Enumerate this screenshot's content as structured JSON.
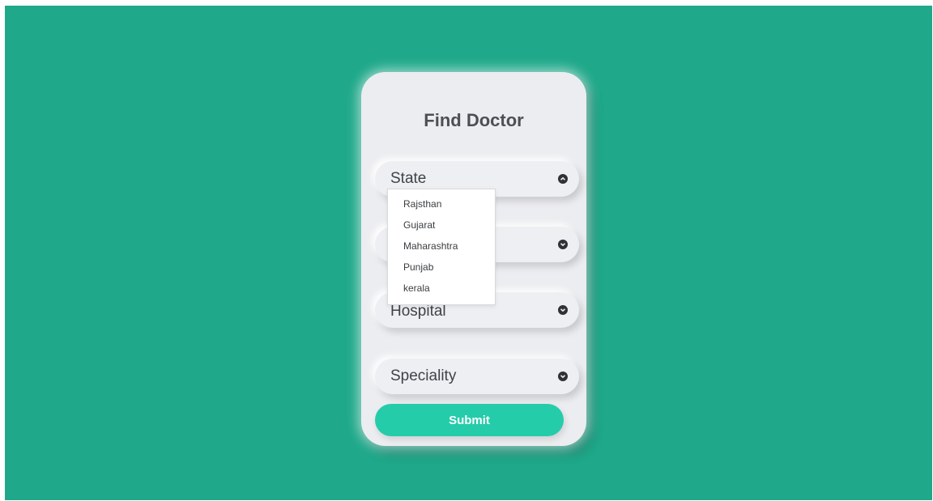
{
  "form": {
    "title": "Find Doctor",
    "fields": [
      {
        "label": "State",
        "open": true
      },
      {
        "label": "",
        "open": false
      },
      {
        "label": "Hospital",
        "open": false
      },
      {
        "label": "Speciality",
        "open": false
      }
    ],
    "state_options": [
      "Rajsthan",
      "Gujarat",
      "Maharashtra",
      "Punjab",
      "kerala"
    ],
    "submit_label": "Submit"
  },
  "colors": {
    "background": "#1fa88a",
    "card": "#ecedf0",
    "accent": "#25ccaa"
  },
  "icons": {
    "field_toggle_open": "chevron-up-circle-icon",
    "field_toggle_closed": "chevron-down-circle-icon"
  }
}
